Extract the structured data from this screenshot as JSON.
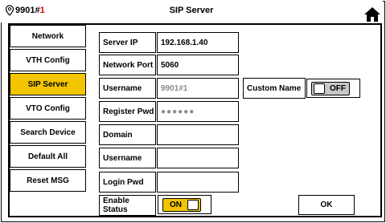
{
  "header": {
    "device_id_prefix": "9901#",
    "device_id_suffix": "1",
    "title": "SIP Server",
    "home_icon": "home-icon",
    "location_icon": "location-pin-icon"
  },
  "menu": {
    "items": [
      {
        "label": "Network",
        "active": false
      },
      {
        "label": "VTH Config",
        "active": false
      },
      {
        "label": "SIP Server",
        "active": true
      },
      {
        "label": "VTO Config",
        "active": false
      },
      {
        "label": "Search Device",
        "active": false
      },
      {
        "label": "Default All",
        "active": false
      },
      {
        "label": "Reset MSG",
        "active": false
      }
    ]
  },
  "form": {
    "server_ip": {
      "label": "Server IP",
      "value": "192.168.1.40"
    },
    "network_port": {
      "label": "Network Port",
      "value": "5060"
    },
    "username": {
      "label": "Username",
      "placeholder": "9901#1"
    },
    "register_pwd": {
      "label": "Register Pwd",
      "masked": "●●●●●●"
    },
    "domain": {
      "label": "Domain",
      "value": ""
    },
    "username2": {
      "label": "Username",
      "value": ""
    },
    "login_pwd": {
      "label": "Login Pwd",
      "value": ""
    },
    "enable_status": {
      "label": "Enable Status",
      "state": "ON"
    },
    "custom_name": {
      "label": "Custom Name",
      "state": "OFF"
    }
  },
  "actions": {
    "ok_label": "OK"
  },
  "colors": {
    "active": "#f2c500",
    "off_switch": "#c8c8c8",
    "device_red": "#e00000"
  }
}
